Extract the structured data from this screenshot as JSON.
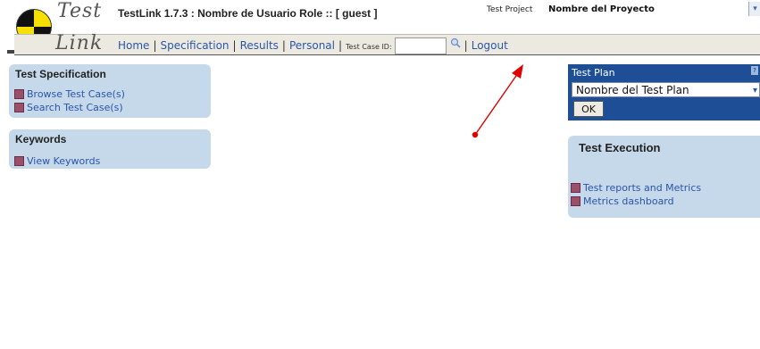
{
  "header": {
    "logo_test": "Test",
    "logo_link": "Link",
    "title": "TestLink 1.7.3 : Nombre de Usuario Role :: [ guest ]",
    "project_label": "Test Project",
    "project_name": "Nombre del Proyecto"
  },
  "nav": {
    "home": "Home",
    "specification": "Specification",
    "results": "Results",
    "personal": "Personal",
    "test_case_id_label": "Test Case ID:",
    "test_case_id_value": "",
    "logout": "Logout",
    "separator": "|"
  },
  "test_specification": {
    "title": "Test Specification",
    "items": [
      "Browse Test Case(s)",
      "Search Test Case(s)"
    ]
  },
  "keywords": {
    "title": "Keywords",
    "items": [
      "View Keywords"
    ]
  },
  "test_plan": {
    "label": "Test Plan",
    "selected": "Nombre del Test Plan",
    "ok_label": "OK"
  },
  "test_execution": {
    "title": "Test Execution",
    "items": [
      "Test reports and Metrics",
      "Metrics dashboard"
    ]
  },
  "colors": {
    "link": "#2a55a8",
    "panel_bg": "#c6d9ea",
    "test_plan_bg": "#1e4f96",
    "annotation": "#e00000"
  }
}
